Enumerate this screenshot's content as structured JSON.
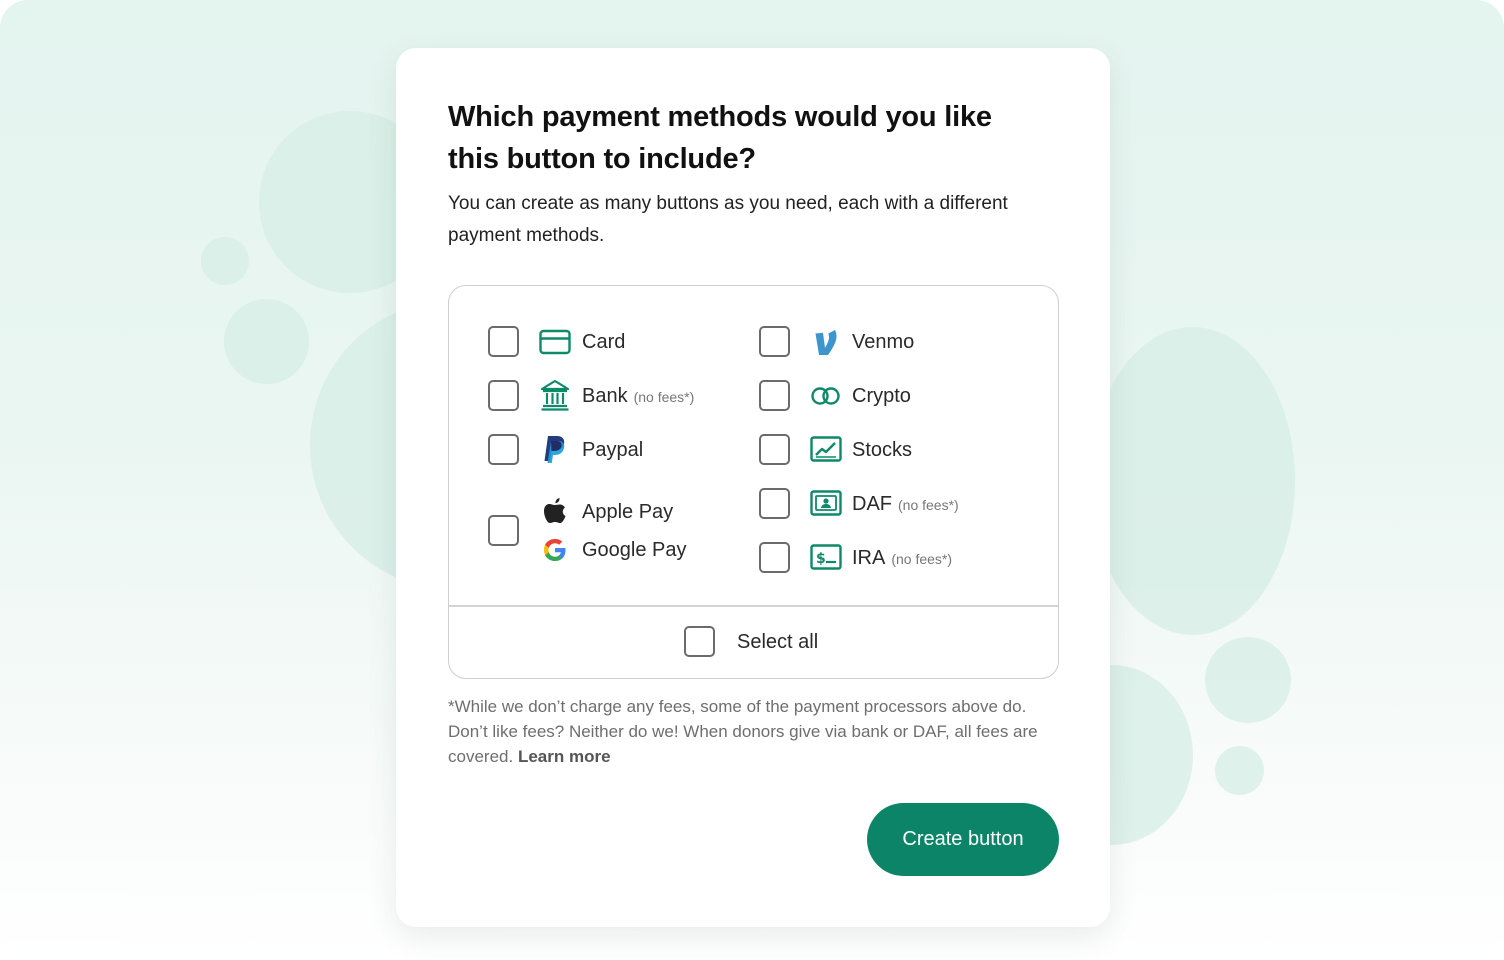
{
  "dialog": {
    "title": "Which payment methods would you like this button to include?",
    "subtitle": "You can create as many buttons as you need, each with a different payment methods."
  },
  "methods": {
    "card": {
      "label": "Card",
      "icon": "card-icon"
    },
    "bank": {
      "label": "Bank",
      "note": "(no fees*)",
      "icon": "bank-icon"
    },
    "paypal": {
      "label": "Paypal",
      "icon": "paypal-icon"
    },
    "apple_pay": {
      "label": "Apple Pay",
      "icon": "apple-icon"
    },
    "google_pay": {
      "label": "Google Pay",
      "icon": "google-icon"
    },
    "venmo": {
      "label": "Venmo",
      "icon": "venmo-icon"
    },
    "crypto": {
      "label": "Crypto",
      "icon": "crypto-icon"
    },
    "stocks": {
      "label": "Stocks",
      "icon": "stocks-icon"
    },
    "daf": {
      "label": "DAF",
      "note": "(no fees*)",
      "icon": "daf-icon"
    },
    "ira": {
      "label": "IRA",
      "note": "(no fees*)",
      "icon": "ira-icon"
    }
  },
  "select_all": {
    "label": "Select all"
  },
  "footnote": {
    "text": "*While we don’t charge any fees, some of the payment processors above do. Don’t like fees? Neither do we! When donors give via bank or DAF, all fees are covered. ",
    "link": "Learn more"
  },
  "actions": {
    "create_button": "Create button"
  },
  "colors": {
    "accent": "#0b8468",
    "icon_green": "#0e8a6a",
    "background": "#e4f4ef"
  }
}
